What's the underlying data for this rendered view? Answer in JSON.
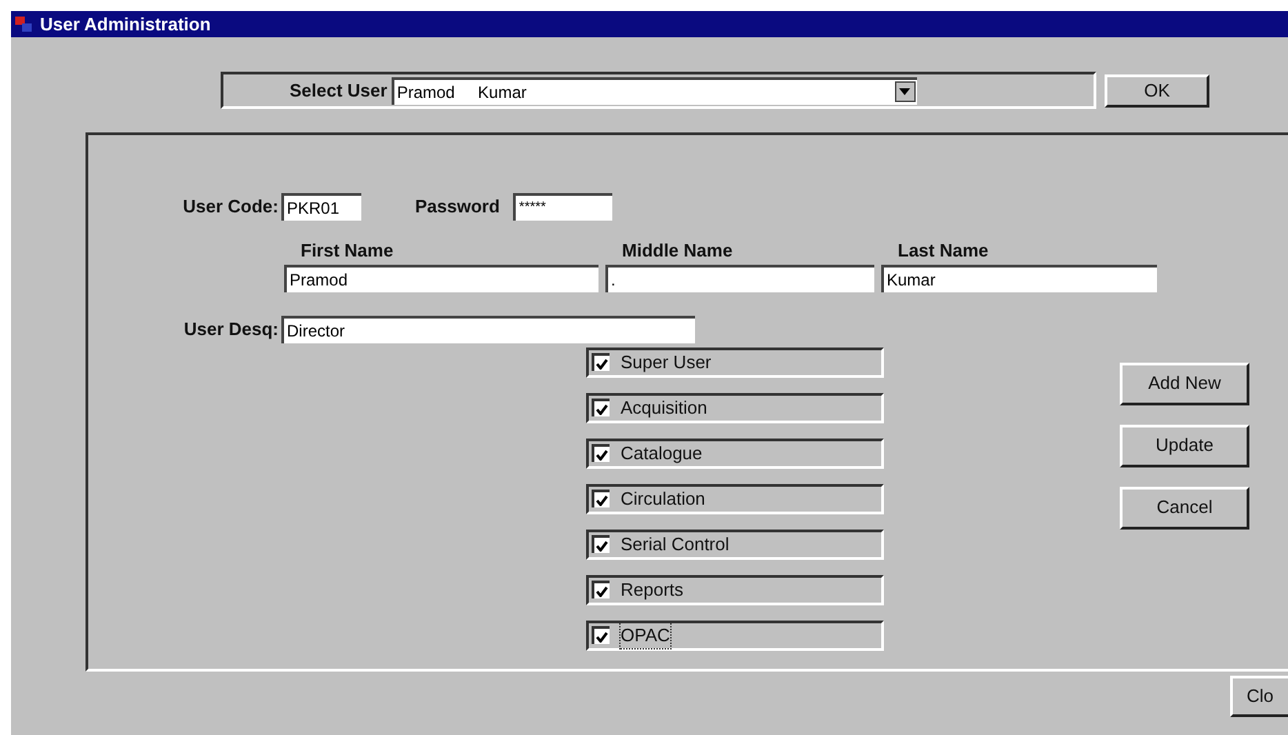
{
  "window": {
    "title": "User Administration"
  },
  "select_user": {
    "label": "Select User",
    "value": "Pramod     Kumar"
  },
  "ok_button": "OK",
  "user_code": {
    "label": "User Code:",
    "value": "PKR01"
  },
  "password": {
    "label": "Password",
    "value": "*****"
  },
  "name_fields": [
    {
      "label": "First Name",
      "value": "Pramod"
    },
    {
      "label": "Middle Name",
      "value": "."
    },
    {
      "label": "Last Name",
      "value": "Kumar"
    }
  ],
  "user_desq": {
    "label": "User Desq:",
    "value": "Director"
  },
  "permissions": [
    {
      "label": "Super User",
      "checked": true,
      "focused": false
    },
    {
      "label": "Acquisition",
      "checked": true,
      "focused": false
    },
    {
      "label": "Catalogue",
      "checked": true,
      "focused": false
    },
    {
      "label": "Circulation",
      "checked": true,
      "focused": false
    },
    {
      "label": "Serial Control",
      "checked": true,
      "focused": false
    },
    {
      "label": "Reports",
      "checked": true,
      "focused": false
    },
    {
      "label": "OPAC",
      "checked": true,
      "focused": true
    }
  ],
  "buttons": [
    "Add New",
    "Update",
    "Cancel"
  ],
  "close_button": "Clo"
}
